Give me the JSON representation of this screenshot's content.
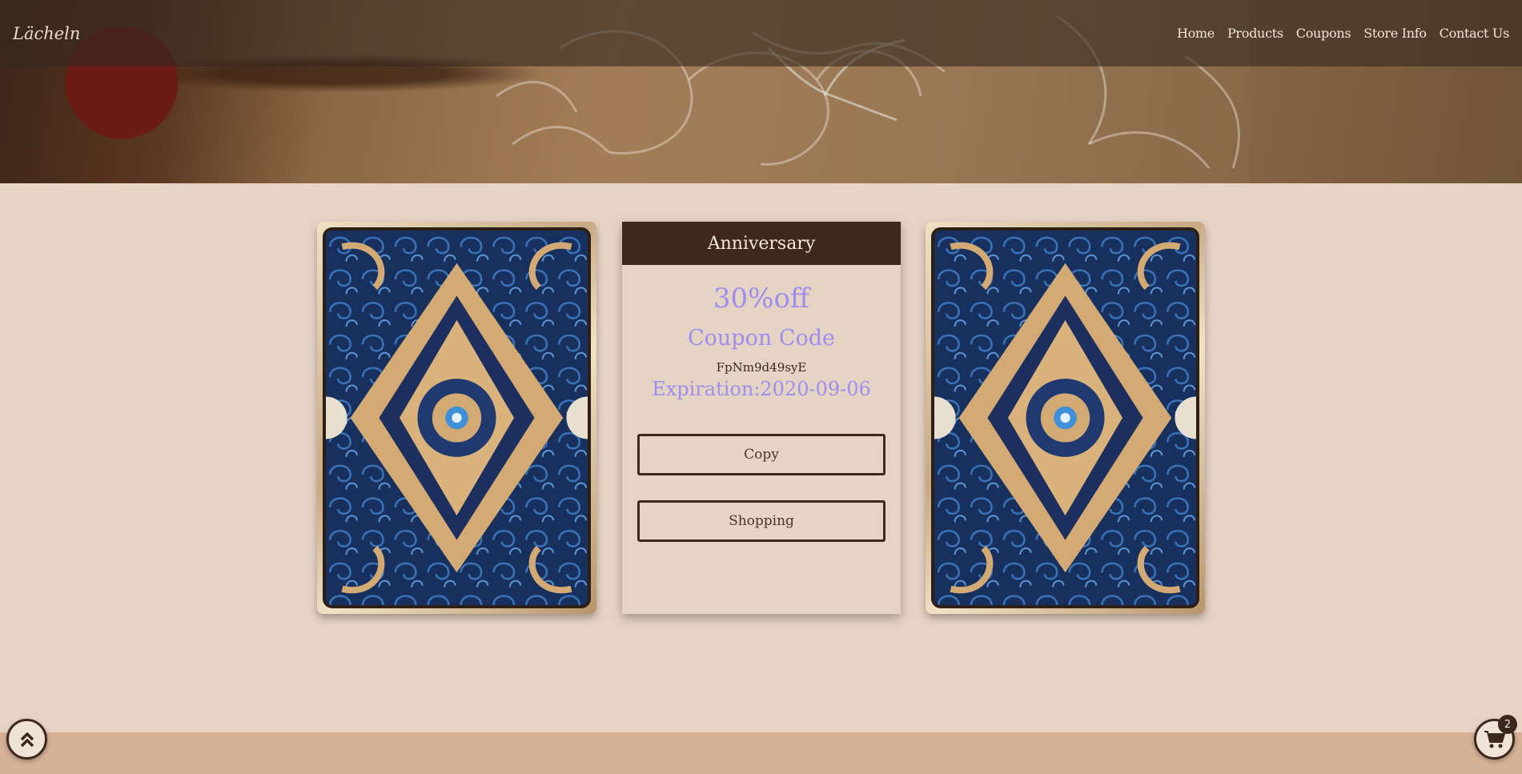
{
  "brand": "Lächeln",
  "nav": [
    "Home",
    "Products",
    "Coupons",
    "Store Info",
    "Contact Us"
  ],
  "coupon": {
    "title": "Anniversary",
    "discount": "30%off",
    "label": "Coupon Code",
    "code": "FpNm9d49syE",
    "expiration": "Expiration:2020-09-06",
    "copy_label": "Copy",
    "shopping_label": "Shopping"
  },
  "cart": {
    "count": "2"
  },
  "icons": {
    "back_to_top": "chevron-double-up-icon",
    "cart": "shopping-cart-icon"
  },
  "colors": {
    "page_bg": "#e6d3c4",
    "header_dark": "#3e281c",
    "accent_text": "#9d8ef0",
    "footer_band": "#d5b196"
  }
}
